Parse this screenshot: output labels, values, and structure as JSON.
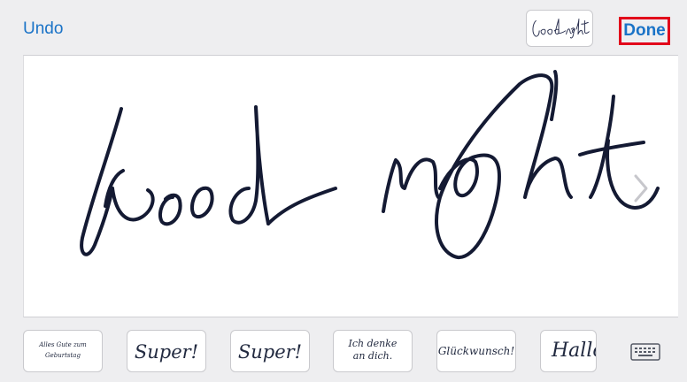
{
  "toolbar": {
    "undo_label": "Undo",
    "done_label": "Done"
  },
  "canvas": {
    "text": "Good night",
    "ink_color": "#141a33"
  },
  "strip": {
    "cards": [
      {
        "label": "Alles Gute zum Geburtstag"
      },
      {
        "label": "Super!"
      },
      {
        "label": "Super!"
      },
      {
        "label": "Ich denke an dich."
      },
      {
        "label": "Glückwunsch!"
      },
      {
        "label": "Hallo"
      }
    ],
    "keyboard_icon": "keyboard-icon"
  },
  "colors": {
    "accent": "#1a73c7",
    "highlight": "#e2001b",
    "background": "#eeeef0"
  }
}
